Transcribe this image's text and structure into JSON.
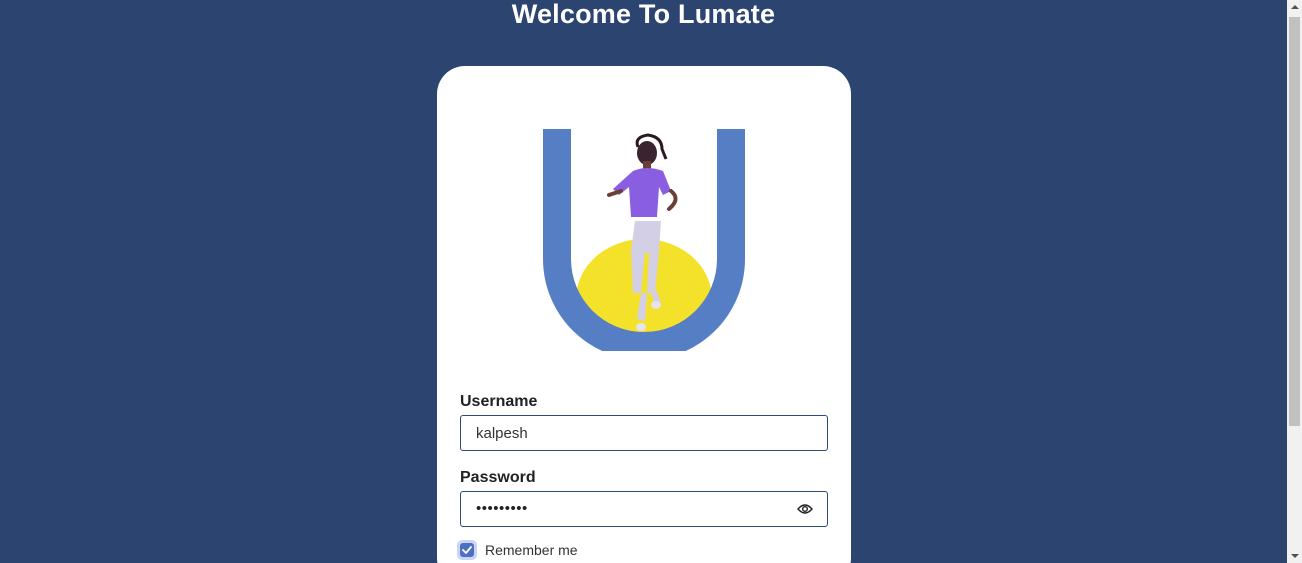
{
  "page": {
    "title": "Welcome To Lumate"
  },
  "hero": {
    "image": "lumate-u-logo-with-jumping-person",
    "colors": {
      "u_shape": "#567ec5",
      "sun": "#f4e12a",
      "shirt": "#8a5ee0"
    }
  },
  "form": {
    "username_label": "Username",
    "username_value": "kalpesh",
    "password_label": "Password",
    "password_masked": "•••••••••",
    "password_toggle_icon": "eye-icon",
    "remember_label": "Remember me",
    "remember_checked": true
  },
  "colors": {
    "background": "#2c4470",
    "card": "#ffffff",
    "field_border": "#2c4a7c",
    "checkbox": "#4d6fc4"
  }
}
